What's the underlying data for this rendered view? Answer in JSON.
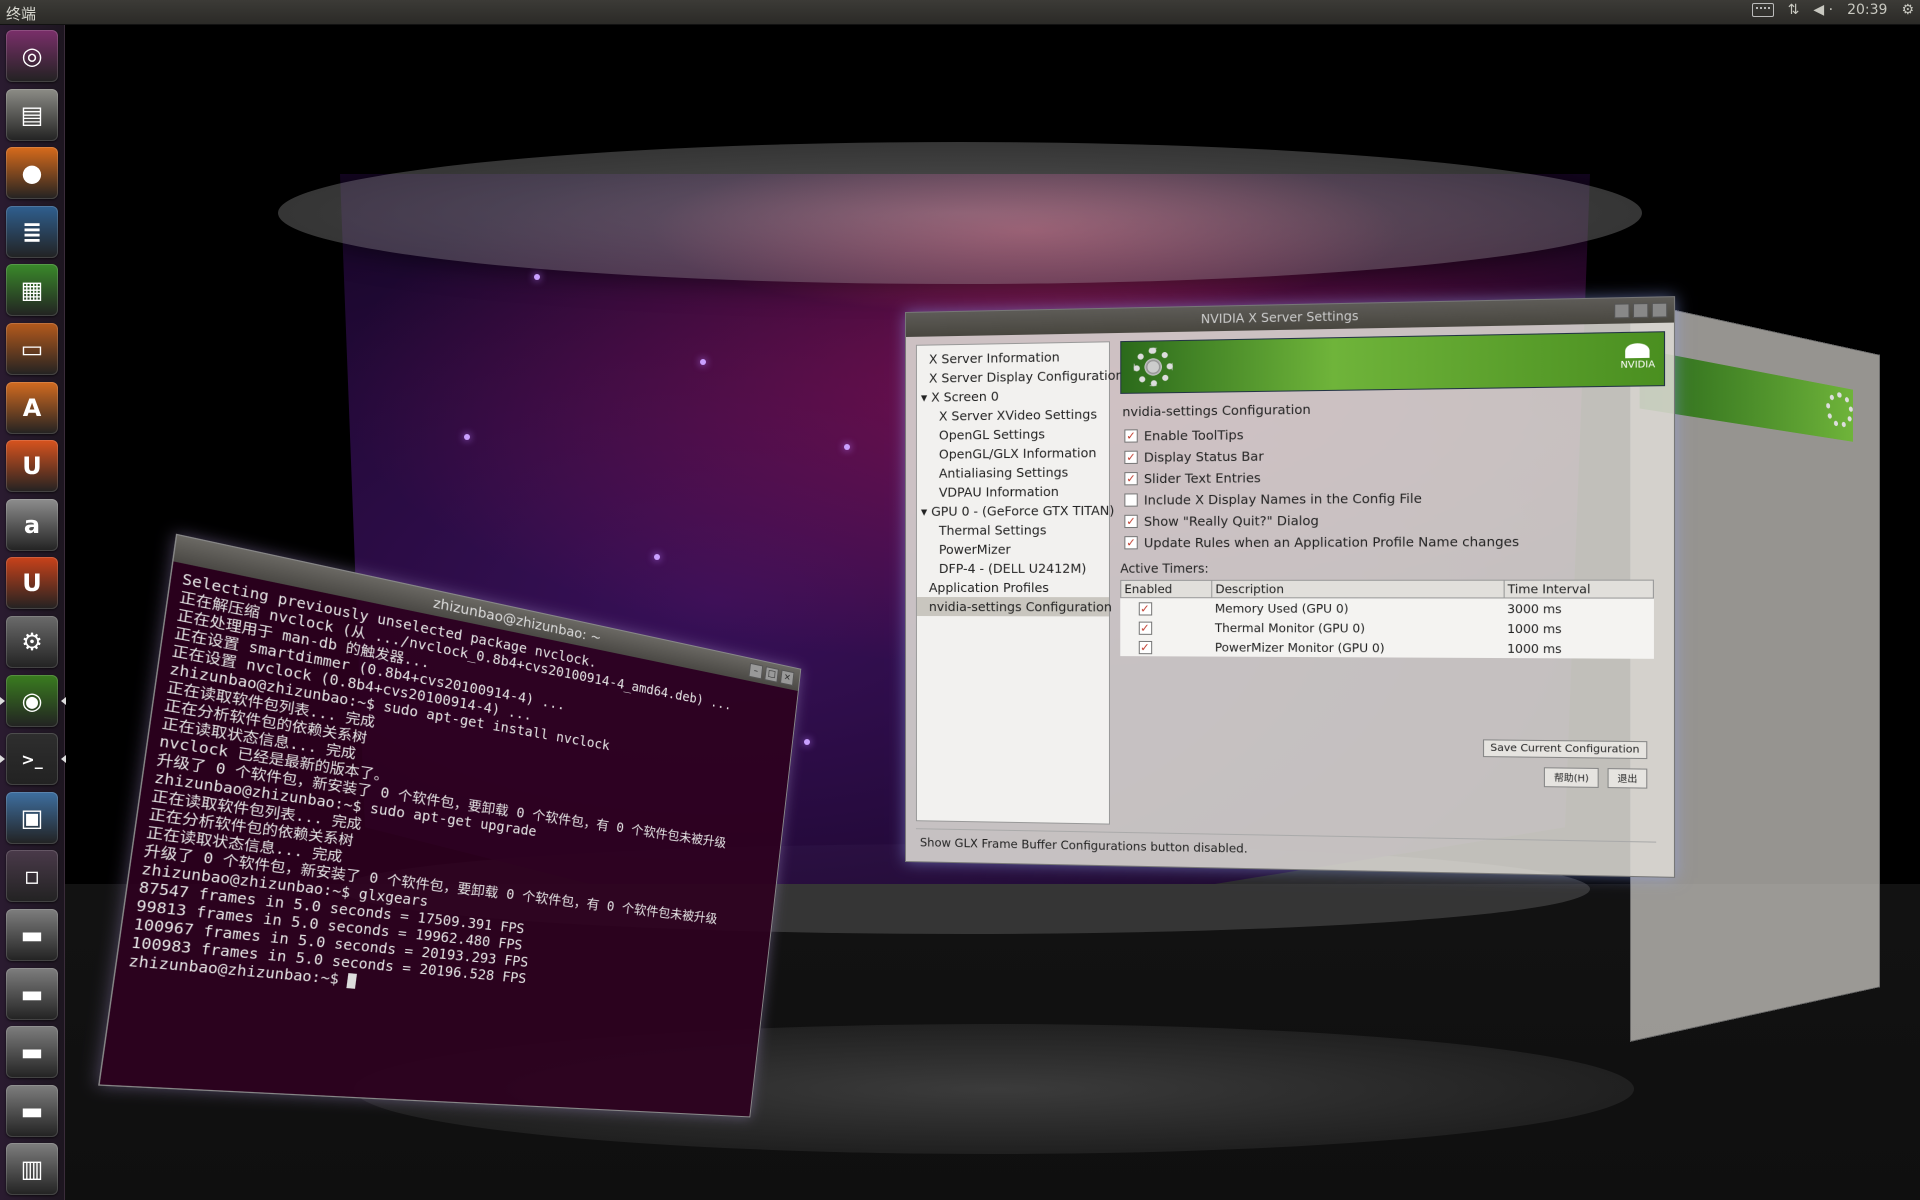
{
  "top_panel": {
    "title": "终端",
    "clock": "20:39"
  },
  "launcher": {
    "items": [
      {
        "name": "dash-home-button",
        "icon": "ubuntu-logo-icon",
        "color": "#7a2f6a"
      },
      {
        "name": "files-button",
        "icon": "file-cabinet-icon",
        "color": "#8c8c86"
      },
      {
        "name": "firefox-button",
        "icon": "firefox-icon",
        "color": "#d86b1b"
      },
      {
        "name": "writer-button",
        "icon": "document-icon",
        "color": "#2f5f8f"
      },
      {
        "name": "calc-button",
        "icon": "spreadsheet-icon",
        "color": "#3a8a2a"
      },
      {
        "name": "impress-button",
        "icon": "presentation-icon",
        "color": "#b55a1c"
      },
      {
        "name": "software-center-button",
        "icon": "shopping-bag-icon",
        "color": "#d36b20"
      },
      {
        "name": "ubuntu-one-button",
        "icon": "u-icon",
        "color": "#d8531e"
      },
      {
        "name": "amazon-button",
        "icon": "amazon-icon",
        "color": "#8d8d8d"
      },
      {
        "name": "ubuntu-one-music-button",
        "icon": "u-bag-icon",
        "color": "#c9421a"
      },
      {
        "name": "system-settings-button",
        "icon": "wrench-gear-icon",
        "color": "#6b6b6b"
      },
      {
        "name": "nvidia-settings-button",
        "icon": "nvidia-eye-icon",
        "color": "#3a7d1f",
        "active": true
      },
      {
        "name": "terminal-button",
        "icon": "terminal-icon",
        "color": "#2e2e2e",
        "active": true
      },
      {
        "name": "display-settings-button",
        "icon": "monitor-icon",
        "color": "#3e6fa0"
      },
      {
        "name": "workspace-switcher-button",
        "icon": "workspaces-icon",
        "color": "#4a3a4a"
      },
      {
        "name": "drive-1-button",
        "icon": "hard-drive-icon",
        "color": "#7e7e7e"
      },
      {
        "name": "drive-2-button",
        "icon": "hard-drive-icon",
        "color": "#7e7e7e"
      },
      {
        "name": "drive-3-button",
        "icon": "hard-drive-icon",
        "color": "#7e7e7e"
      },
      {
        "name": "drive-4-button",
        "icon": "hard-drive-icon",
        "color": "#7e7e7e"
      },
      {
        "name": "trash-button",
        "icon": "trash-icon",
        "color": "#7e7e7e"
      }
    ]
  },
  "nvidia": {
    "title": "NVIDIA X Server Settings",
    "tree": [
      {
        "label": "X Server Information",
        "level": 1
      },
      {
        "label": "X Server Display Configuration",
        "level": 1
      },
      {
        "label": "X Screen 0",
        "level": 0
      },
      {
        "label": "X Server XVideo Settings",
        "level": 2
      },
      {
        "label": "OpenGL Settings",
        "level": 2
      },
      {
        "label": "OpenGL/GLX Information",
        "level": 2
      },
      {
        "label": "Antialiasing Settings",
        "level": 2
      },
      {
        "label": "VDPAU Information",
        "level": 2
      },
      {
        "label": "GPU 0 - (GeForce GTX TITAN)",
        "level": 0
      },
      {
        "label": "Thermal Settings",
        "level": 2
      },
      {
        "label": "PowerMizer",
        "level": 2
      },
      {
        "label": "DFP-4 - (DELL U2412M)",
        "level": 2
      },
      {
        "label": "Application Profiles",
        "level": 1
      },
      {
        "label": "nvidia-settings Configuration",
        "level": 1,
        "selected": true
      }
    ],
    "section_title": "nvidia-settings Configuration",
    "options": [
      {
        "label": "Enable ToolTips",
        "checked": true
      },
      {
        "label": "Display Status Bar",
        "checked": true
      },
      {
        "label": "Slider Text Entries",
        "checked": true
      },
      {
        "label": "Include X Display Names in the Config File",
        "checked": false
      },
      {
        "label": "Show \"Really Quit?\" Dialog",
        "checked": true
      },
      {
        "label": "Update Rules when an Application Profile Name changes",
        "checked": true
      }
    ],
    "timers_label": "Active Timers:",
    "timer_headers": [
      "Enabled",
      "Description",
      "Time Interval"
    ],
    "timers": [
      {
        "enabled": true,
        "description": "Memory Used (GPU 0)",
        "interval": "3000 ms"
      },
      {
        "enabled": true,
        "description": "Thermal Monitor (GPU 0)",
        "interval": "1000 ms"
      },
      {
        "enabled": true,
        "description": "PowerMizer Monitor (GPU 0)",
        "interval": "1000 ms"
      }
    ],
    "save_button": "Save Current Configuration",
    "help_button": "帮助(H)",
    "quit_button": "退出",
    "status_bar": "Show GLX Frame Buffer Configurations button disabled.",
    "banner_logo_text": "NVIDIA"
  },
  "terminal": {
    "title": "zhizunbao@zhizunbao: ~",
    "lines": [
      "Selecting previously unselected package nvclock.",
      "正在解压缩 nvclock (从 .../nvclock_0.8b4+cvs20100914-4_amd64.deb) ...",
      "正在处理用于 man-db 的触发器...",
      "正在设置 smartdimmer (0.8b4+cvs20100914-4) ...",
      "正在设置 nvclock (0.8b4+cvs20100914-4) ...",
      "zhizunbao@zhizunbao:~$ sudo apt-get install nvclock",
      "正在读取软件包列表... 完成",
      "正在分析软件包的依赖关系树",
      "正在读取状态信息... 完成",
      "nvclock 已经是最新的版本了。",
      "升级了 0 个软件包，新安装了 0 个软件包，要卸载 0 个软件包，有 0 个软件包未被升级",
      "zhizunbao@zhizunbao:~$ sudo apt-get upgrade",
      "正在读取软件包列表... 完成",
      "正在分析软件包的依赖关系树",
      "正在读取状态信息... 完成",
      "升级了 0 个软件包，新安装了 0 个软件包，要卸载 0 个软件包，有 0 个软件包未被升级",
      "zhizunbao@zhizunbao:~$ glxgears",
      "87547 frames in 5.0 seconds = 17509.391 FPS",
      "99813 frames in 5.0 seconds = 19962.480 FPS",
      "100967 frames in 5.0 seconds = 20193.293 FPS",
      "100983 frames in 5.0 seconds = 20196.528 FPS",
      "zhizunbao@zhizunbao:~$ "
    ]
  }
}
